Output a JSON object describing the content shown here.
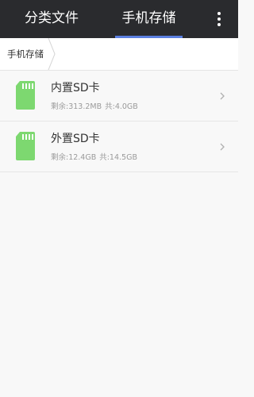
{
  "tabs": [
    {
      "label": "分类文件",
      "selected": false
    },
    {
      "label": "手机存储",
      "selected": true
    }
  ],
  "overflow_menu_icon": "more-vertical-icon",
  "breadcrumb": [
    "手机存储"
  ],
  "storages": [
    {
      "name": "内置SD卡",
      "free": "剩余:313.2MB",
      "total": "共:4.0GB",
      "icon": "sd-card-icon"
    },
    {
      "name": "外置SD卡",
      "free": "剩余:12.4GB",
      "total": "共:14.5GB",
      "icon": "sd-card-icon"
    }
  ],
  "colors": {
    "topbar": "#2a2b2e",
    "tab_indicator": "#5b7fe0",
    "sd_icon": "#7dd870",
    "background": "#f8f8f8"
  }
}
